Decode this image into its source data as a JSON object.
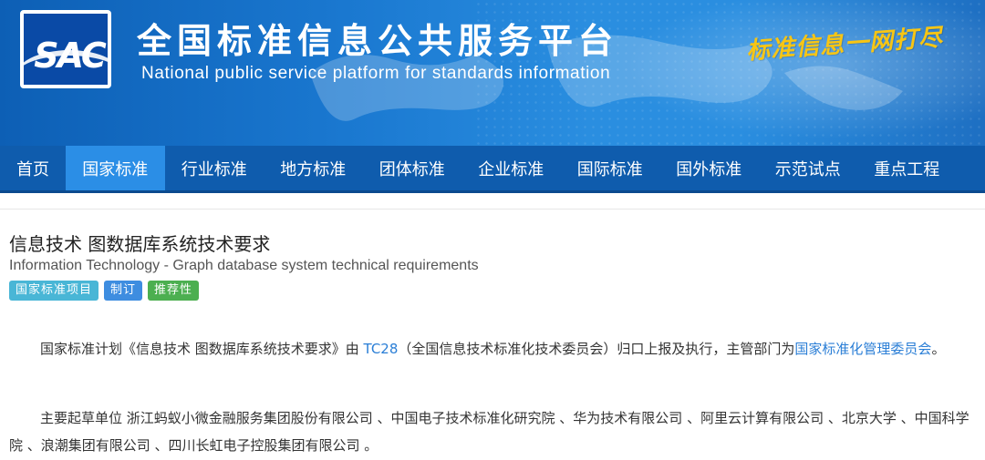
{
  "banner": {
    "logo_text": "SAC",
    "title_cn": "全国标准信息公共服务平台",
    "title_en": "National public service platform  for standards information",
    "slogan": "标准信息一网打尽"
  },
  "nav": {
    "items": [
      {
        "label": "首页"
      },
      {
        "label": "国家标准"
      },
      {
        "label": "行业标准"
      },
      {
        "label": "地方标准"
      },
      {
        "label": "团体标准"
      },
      {
        "label": "企业标准"
      },
      {
        "label": "国际标准"
      },
      {
        "label": "国外标准"
      },
      {
        "label": "示范试点"
      },
      {
        "label": "重点工程"
      }
    ],
    "active": "国家标准"
  },
  "standard": {
    "title": "信息技术 图数据库系统技术要求",
    "title_en": "Information Technology - Graph database system technical requirements",
    "tags": [
      "国家标准项目",
      "制订",
      "推荐性"
    ]
  },
  "description": {
    "p1_prefix": "国家标准计划《信息技术 图数据库系统技术要求》由 ",
    "tc_link": "TC28",
    "p1_middle": "（全国信息技术标准化技术委员会）归口上报及执行，主管部门为",
    "authority_link": "国家标准化管理委员会",
    "p1_suffix": "。",
    "p2": "主要起草单位 浙江蚂蚁小微金融服务集团股份有限公司 、中国电子技术标准化研究院 、华为技术有限公司 、阿里云计算有限公司 、北京大学 、中国科学院 、浪潮集团有限公司 、四川长虹电子控股集团有限公司 。"
  },
  "colors": {
    "banner_blue": "#1a78d0",
    "nav_blue": "#0f5cad",
    "nav_active": "#2b8ee6",
    "slogan_gold": "#f7c514",
    "link_blue": "#2a7ed6",
    "tag_project": "#49b6d6",
    "tag_revise": "#3e8de0",
    "tag_recommend": "#4caf50"
  }
}
